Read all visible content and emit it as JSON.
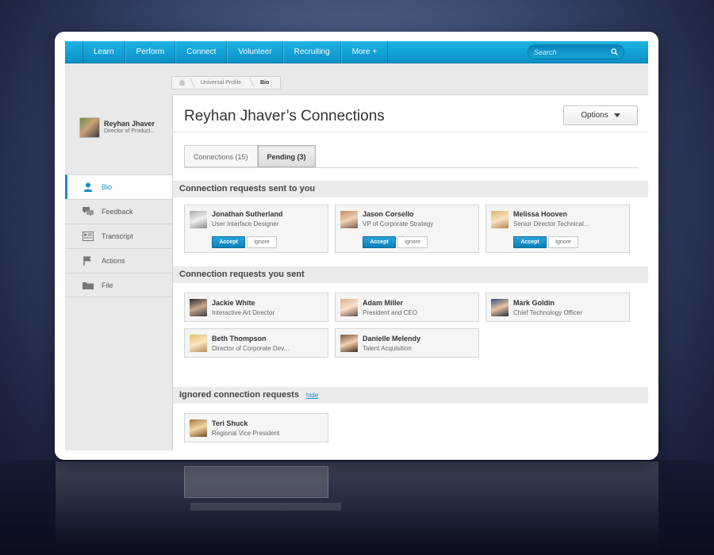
{
  "nav": {
    "items": [
      "Learn",
      "Perform",
      "Connect",
      "Volunteer",
      "Recruiting",
      "More +"
    ],
    "search_placeholder": "Search"
  },
  "breadcrumb": {
    "items": [
      "Universal Profile",
      "Bio"
    ]
  },
  "profile": {
    "name": "Reyhan Jhaver",
    "title": "Director of Product..."
  },
  "sidebar": {
    "items": [
      {
        "label": "Bio",
        "icon": "person-icon",
        "active": true
      },
      {
        "label": "Feedback",
        "icon": "speech-bubbles-icon"
      },
      {
        "label": "Transcript",
        "icon": "transcript-icon"
      },
      {
        "label": "Actions",
        "icon": "flag-icon"
      },
      {
        "label": "File",
        "icon": "folder-icon"
      }
    ]
  },
  "main": {
    "title": "Reyhan Jhaver’s Connections",
    "options_label": "Options",
    "tabs": [
      {
        "label": "Connections (15)",
        "active": false
      },
      {
        "label": "Pending (3)",
        "active": true
      }
    ]
  },
  "received": {
    "heading": "Connection requests sent to you",
    "accept_label": "Accept",
    "ignore_label": "Ignore",
    "people": [
      {
        "name": "Jonathan Sutherland",
        "title": "User Interface Designer"
      },
      {
        "name": "Jason Corsello",
        "title": "VP of Corporate Strategy"
      },
      {
        "name": "Melissa Hooven",
        "title": "Senior Director Technical..."
      }
    ]
  },
  "sent": {
    "heading": "Connection requests you sent",
    "people": [
      {
        "name": "Jackie White",
        "title": "Interactive Art Director"
      },
      {
        "name": "Adam Miller",
        "title": "President and CEO"
      },
      {
        "name": "Mark Goldin",
        "title": "Chief Technology Officer"
      },
      {
        "name": "Beth Thompson",
        "title": "Director of Corporate Dev..."
      },
      {
        "name": "Danielle Melendy",
        "title": "Talent Acquisition"
      }
    ]
  },
  "ignored": {
    "heading": "Ignored connection requests",
    "hide_label": "hide",
    "people": [
      {
        "name": "Teri Shuck",
        "title": "Regional Vice President"
      }
    ]
  },
  "colors": {
    "accent": "#1a8cc7",
    "nav_top": "#1fb2e4",
    "nav_bottom": "#0891c8"
  }
}
